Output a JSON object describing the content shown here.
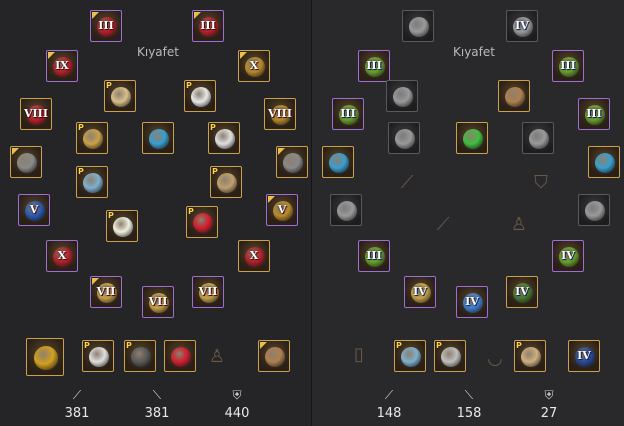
{
  "left_panel": {
    "title": "Kıyafet",
    "stats": [
      {
        "icon": "sword-icon",
        "value": "381"
      },
      {
        "icon": "blade-icon",
        "value": "381"
      },
      {
        "icon": "shield-icon",
        "value": "440"
      }
    ],
    "slots": [
      {
        "name": "helmet",
        "tier": "III",
        "frame": "purple",
        "badge": "corner",
        "color": "#b5202a"
      },
      {
        "name": "helmet-2",
        "tier": "III",
        "frame": "purple",
        "badge": "corner",
        "color": "#b5202a"
      },
      {
        "name": "necklace",
        "tier": "IX",
        "frame": "purple",
        "badge": "corner",
        "color": "#b5202a"
      },
      {
        "name": "ring-top",
        "tier": "X",
        "frame": "gold",
        "badge": "corner",
        "color": "#b88a2a"
      },
      {
        "name": "hair",
        "tier": "",
        "frame": "gold",
        "badge": "P",
        "color": "#d9c08a"
      },
      {
        "name": "costume-top",
        "tier": "",
        "frame": "gold",
        "badge": "P",
        "color": "#e8e8e8"
      },
      {
        "name": "earring-left",
        "tier": "VIII",
        "frame": "gold",
        "badge": "",
        "color": "#b5202a"
      },
      {
        "name": "earring-right",
        "tier": "VIII",
        "frame": "gold",
        "badge": "",
        "color": "#b88a2a"
      },
      {
        "name": "boots-costume",
        "tier": "",
        "frame": "gold",
        "badge": "P",
        "color": "#c9a24a"
      },
      {
        "name": "orb",
        "tier": "",
        "frame": "gold",
        "badge": "",
        "color": "#3aa0d0"
      },
      {
        "name": "dress",
        "tier": "",
        "frame": "gold",
        "badge": "P",
        "color": "#e0e0e0"
      },
      {
        "name": "armor-left",
        "tier": "",
        "frame": "gold",
        "badge": "corner",
        "color": "#8a8a8a"
      },
      {
        "name": "armor-right",
        "tier": "",
        "frame": "gold",
        "badge": "corner",
        "color": "#8a8a8a"
      },
      {
        "name": "spear",
        "tier": "",
        "frame": "gold",
        "badge": "P",
        "color": "#7fb0d0"
      },
      {
        "name": "pick",
        "tier": "",
        "frame": "gold",
        "badge": "P",
        "color": "#c0a070"
      },
      {
        "name": "glove-left",
        "tier": "V",
        "frame": "purple",
        "badge": "",
        "color": "#2a5ab5"
      },
      {
        "name": "glove-right",
        "tier": "V",
        "frame": "purple",
        "badge": "corner",
        "color": "#b88a2a"
      },
      {
        "name": "bouquet",
        "tier": "",
        "frame": "gold",
        "badge": "P",
        "color": "#f0f0e0"
      },
      {
        "name": "bikini",
        "tier": "",
        "frame": "gold",
        "badge": "P",
        "color": "#d02030"
      },
      {
        "name": "belt-left",
        "tier": "X",
        "frame": "purple",
        "badge": "",
        "color": "#b5202a"
      },
      {
        "name": "belt-right",
        "tier": "X",
        "frame": "gold",
        "badge": "",
        "color": "#b5202a"
      },
      {
        "name": "weapon-1",
        "tier": "VII",
        "frame": "purple",
        "badge": "corner",
        "color": "#c9a24a"
      },
      {
        "name": "weapon-2",
        "tier": "VII",
        "frame": "purple",
        "badge": "",
        "color": "#c9a24a"
      },
      {
        "name": "weapon-3",
        "tier": "VII",
        "frame": "purple",
        "badge": "",
        "color": "#c9a24a"
      },
      {
        "name": "sun-medal",
        "tier": "",
        "frame": "gold",
        "badge": "",
        "color": "#d4a020"
      },
      {
        "name": "clover",
        "tier": "",
        "frame": "gold",
        "badge": "P",
        "color": "#e0e0e0"
      },
      {
        "name": "glasses",
        "tier": "",
        "frame": "gold",
        "badge": "P",
        "color": "#5a5a5a"
      },
      {
        "name": "flag",
        "tier": "",
        "frame": "gold",
        "badge": "",
        "color": "#d02030"
      },
      {
        "name": "fishing-rod",
        "tier": "",
        "frame": "gold",
        "badge": "corner",
        "color": "#b08050"
      }
    ]
  },
  "right_panel": {
    "title": "Kıyafet",
    "stats": [
      {
        "icon": "sword-icon",
        "value": "148"
      },
      {
        "icon": "blade-icon",
        "value": "158"
      },
      {
        "icon": "shield-icon",
        "value": "27"
      }
    ],
    "slots": [
      {
        "name": "helmet",
        "tier": "",
        "frame": "dim",
        "badge": "",
        "color": "#9a9a9a"
      },
      {
        "name": "helmet-2",
        "tier": "IV",
        "frame": "dim",
        "badge": "",
        "color": "#9a9a9a"
      },
      {
        "name": "necklace",
        "tier": "III",
        "frame": "purple",
        "badge": "",
        "color": "#6aa030"
      },
      {
        "name": "ring-top",
        "tier": "III",
        "frame": "purple",
        "badge": "",
        "color": "#6aa030"
      },
      {
        "name": "hair",
        "tier": "",
        "frame": "dim",
        "badge": "",
        "color": "#9a9a9a"
      },
      {
        "name": "costume-top",
        "tier": "",
        "frame": "gold",
        "badge": "",
        "color": "#b08050"
      },
      {
        "name": "earring-left",
        "tier": "III",
        "frame": "purple",
        "badge": "",
        "color": "#6aa030"
      },
      {
        "name": "earring-right",
        "tier": "III",
        "frame": "purple",
        "badge": "",
        "color": "#6aa030"
      },
      {
        "name": "boots-costume",
        "tier": "",
        "frame": "dim",
        "badge": "",
        "color": "#9a9a9a"
      },
      {
        "name": "orb",
        "tier": "",
        "frame": "gold",
        "badge": "",
        "color": "#40c040"
      },
      {
        "name": "dress",
        "tier": "",
        "frame": "dim",
        "badge": "",
        "color": "#9a9a9a"
      },
      {
        "name": "armor-left",
        "tier": "",
        "frame": "gold",
        "badge": "",
        "color": "#3aa0d0"
      },
      {
        "name": "armor-right",
        "tier": "",
        "frame": "gold",
        "badge": "",
        "color": "#3aa0d0"
      },
      {
        "name": "glove-left",
        "tier": "",
        "frame": "dim",
        "badge": "",
        "color": "#9a9a9a"
      },
      {
        "name": "glove-right",
        "tier": "",
        "frame": "dim",
        "badge": "",
        "color": "#9a9a9a"
      },
      {
        "name": "belt-left",
        "tier": "III",
        "frame": "purple",
        "badge": "",
        "color": "#6aa030"
      },
      {
        "name": "belt-right",
        "tier": "IV",
        "frame": "purple",
        "badge": "",
        "color": "#6aa030"
      },
      {
        "name": "weapon-1",
        "tier": "IV",
        "frame": "purple",
        "badge": "",
        "color": "#c9a24a"
      },
      {
        "name": "weapon-2",
        "tier": "IV",
        "frame": "purple",
        "badge": "",
        "color": "#4080d0"
      },
      {
        "name": "weapon-3",
        "tier": "IV",
        "frame": "gold",
        "badge": "",
        "color": "#4a7a30"
      },
      {
        "name": "spear",
        "tier": "",
        "frame": "gold",
        "badge": "P",
        "color": "#7fb0d0"
      },
      {
        "name": "necklace-2",
        "tier": "",
        "frame": "gold",
        "badge": "P",
        "color": "#c0c0c0"
      },
      {
        "name": "pet-dog",
        "tier": "",
        "frame": "gold",
        "badge": "P",
        "color": "#d0b080"
      },
      {
        "name": "book",
        "tier": "IV",
        "frame": "gold",
        "badge": "",
        "color": "#2a4a9a"
      }
    ],
    "ghosts": [
      {
        "name": "dagger-ghost-icon",
        "glyph": "⟋"
      },
      {
        "name": "shield-ghost-icon",
        "glyph": "⛉"
      },
      {
        "name": "knife-ghost-icon",
        "glyph": "⟋"
      },
      {
        "name": "vest-ghost-icon",
        "glyph": "♙"
      },
      {
        "name": "card-ghost-icon",
        "glyph": "▯"
      },
      {
        "name": "lips-ghost-icon",
        "glyph": "◡"
      }
    ]
  },
  "left_ghosts": [
    {
      "name": "coat-ghost-icon",
      "glyph": "♙"
    }
  ]
}
